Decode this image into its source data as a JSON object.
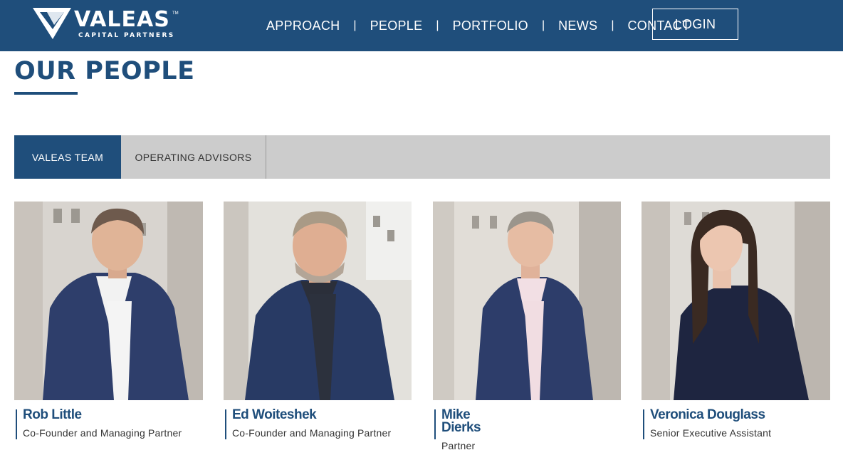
{
  "header": {
    "logo_text": "VALEAS",
    "logo_tm": "TM",
    "logo_sub": "CAPITAL PARTNERS",
    "nav": [
      "APPROACH",
      "PEOPLE",
      "PORTFOLIO",
      "NEWS",
      "CONTACT"
    ],
    "separator": "|",
    "login_label": "LOGIN",
    "bg_color": "#1f4e7b"
  },
  "page": {
    "title": "OUR PEOPLE"
  },
  "tabs": [
    {
      "label": "VALEAS TEAM",
      "active": true
    },
    {
      "label": "OPERATING ADVISORS",
      "active": false
    }
  ],
  "people": [
    {
      "name": "Rob Little",
      "role": "Co-Founder and Managing Partner"
    },
    {
      "name": "Ed Woiteshek",
      "role": "Co-Founder and Managing Partner"
    },
    {
      "name": "Mike Dierks",
      "role": "Partner"
    },
    {
      "name": "Veronica Douglass",
      "role": "Senior Executive Assistant"
    }
  ],
  "colors": {
    "brand_blue": "#1f4e7b",
    "tab_bar_gray": "#cccccc"
  }
}
